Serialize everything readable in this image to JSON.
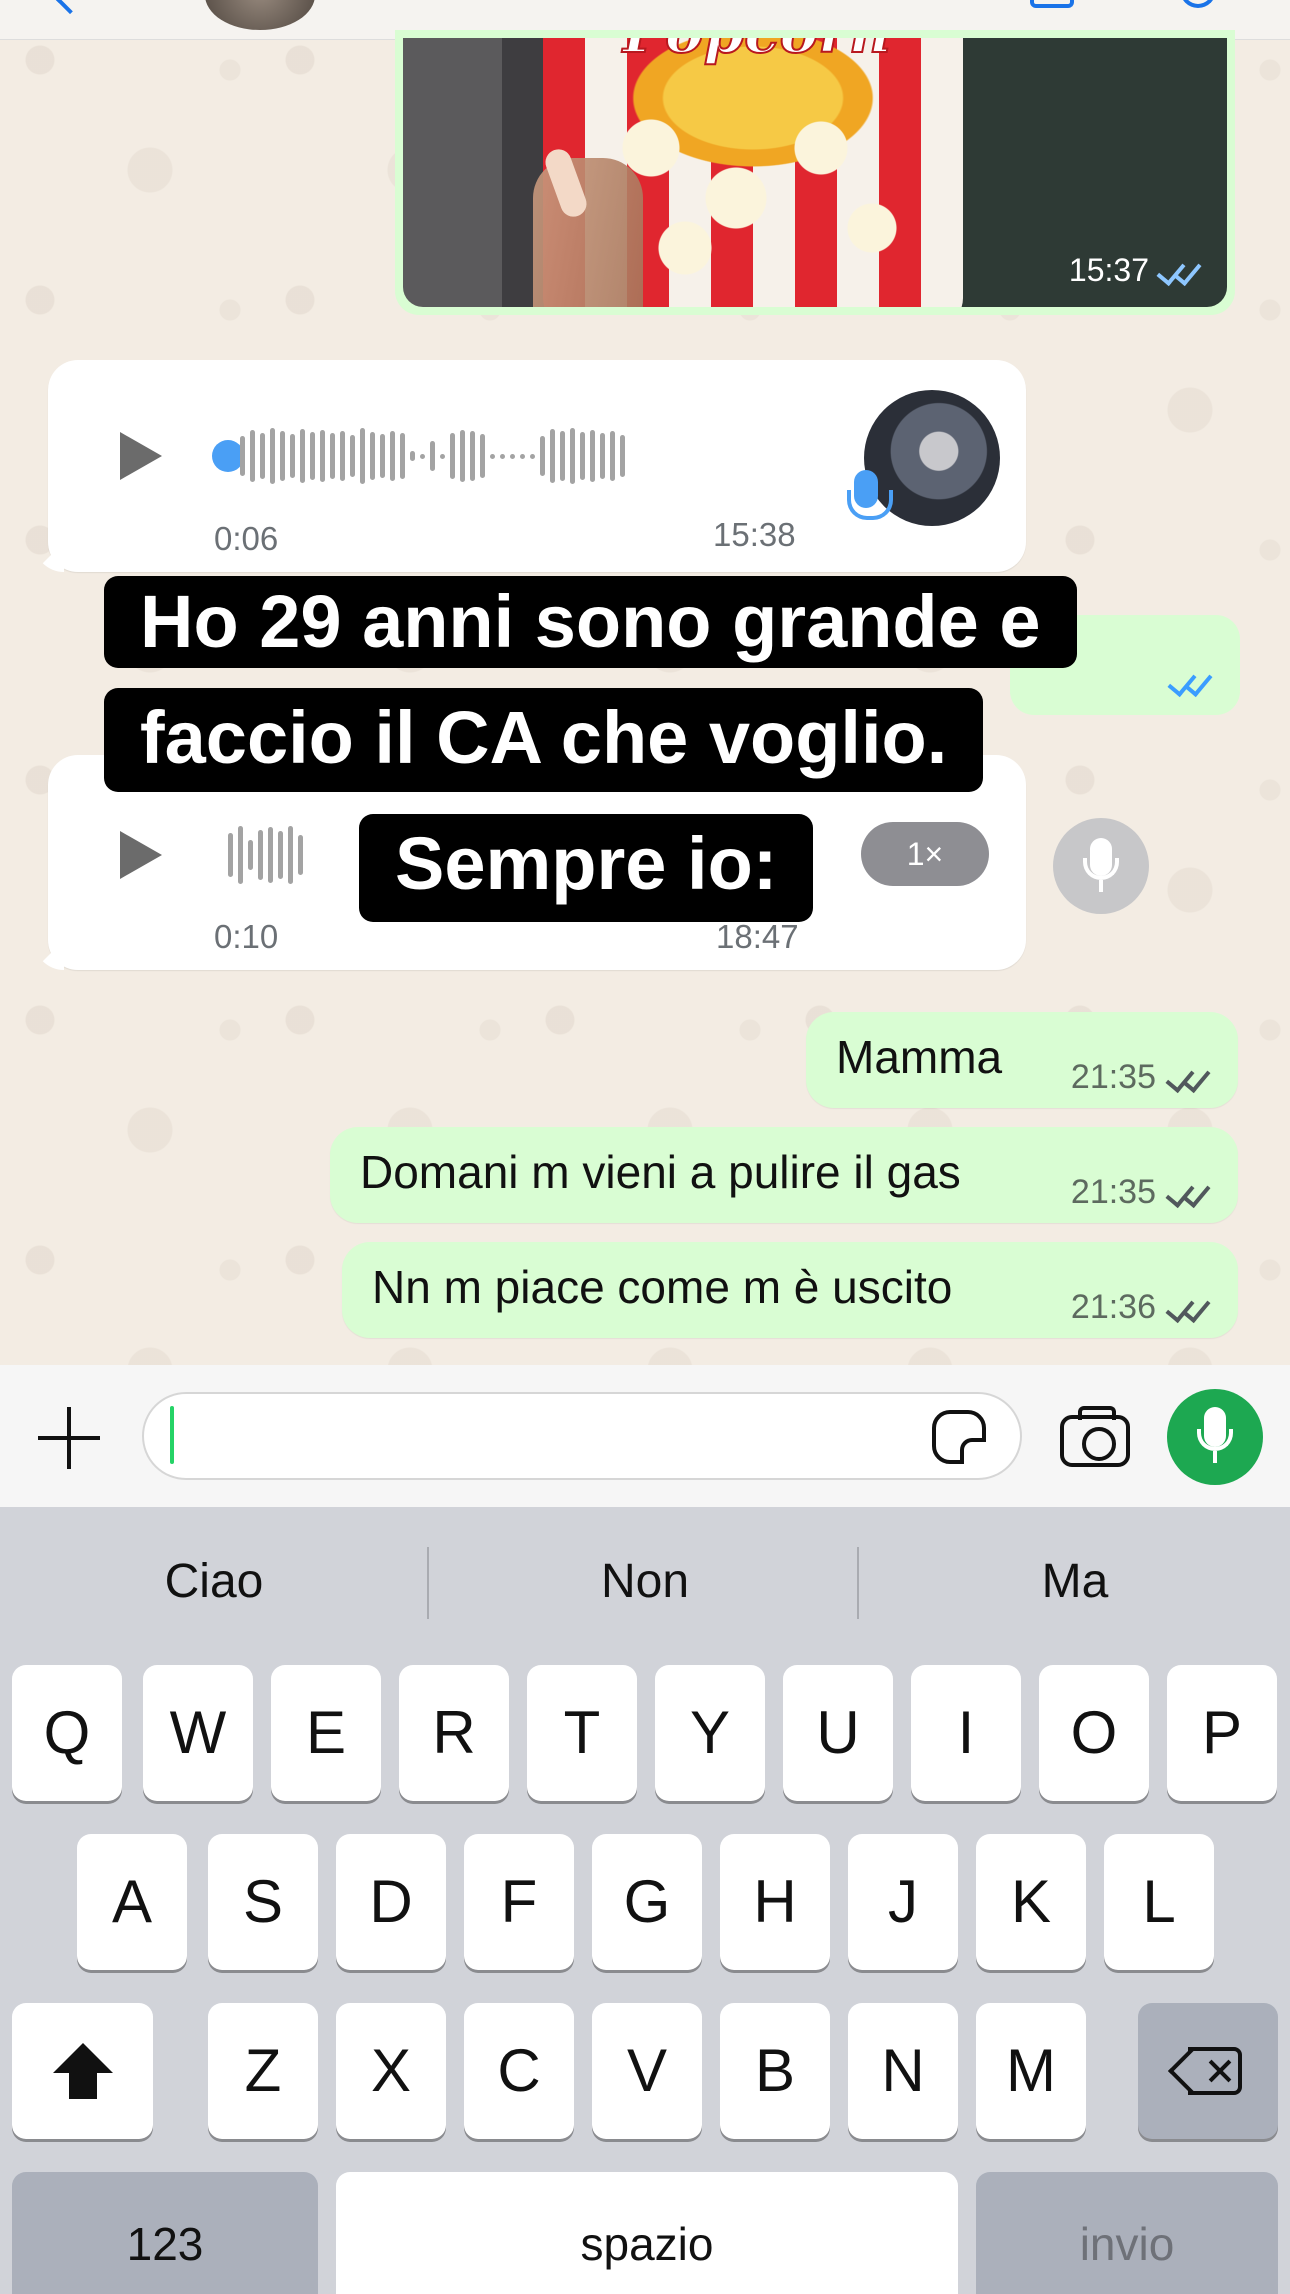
{
  "chat": {
    "image_message": {
      "time": "15:37",
      "status": "read",
      "photo_text": "Popcorn"
    },
    "voice_messages": [
      {
        "duration": "0:06",
        "time": "15:38"
      },
      {
        "duration": "0:10",
        "time": "18:47",
        "speed": "1×"
      }
    ],
    "caption_overlay": {
      "line1": "Ho 29 anni sono grande e",
      "line2": "faccio il CA che voglio.",
      "line3": "Sempre io:"
    },
    "messages": [
      {
        "text": "Mamma",
        "time": "21:35",
        "status": "delivered"
      },
      {
        "text": "Domani m vieni a pulire il gas",
        "time": "21:35",
        "status": "delivered"
      },
      {
        "text": "Nn m piace come m è uscito",
        "time": "21:36",
        "status": "delivered"
      }
    ]
  },
  "input": {
    "value": "",
    "placeholder": ""
  },
  "keyboard": {
    "suggestions": [
      "Ciao",
      "Non",
      "Ma"
    ],
    "row1": [
      "Q",
      "W",
      "E",
      "R",
      "T",
      "Y",
      "U",
      "I",
      "O",
      "P"
    ],
    "row2": [
      "A",
      "S",
      "D",
      "F",
      "G",
      "H",
      "J",
      "K",
      "L"
    ],
    "row3": [
      "Z",
      "X",
      "C",
      "V",
      "B",
      "N",
      "M"
    ],
    "numbers_key": "123",
    "space_key": "spazio",
    "return_key": "invio"
  },
  "colors": {
    "outgoing_bubble": "#d9fdd3",
    "accent_green": "#1da851",
    "read_blue": "#3b9dff"
  }
}
